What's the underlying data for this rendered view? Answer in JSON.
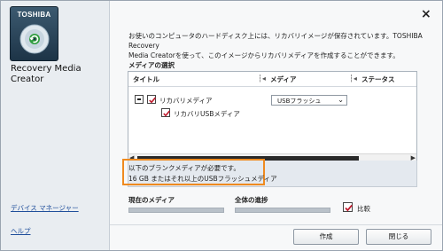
{
  "app": {
    "brand": "TOSHIBA",
    "title_line1": "Recovery Media",
    "title_line2": "Creator"
  },
  "sidebar": {
    "device_manager": "デバイス マネージャー",
    "help": "ヘルプ"
  },
  "close_glyph": "×",
  "message": {
    "line1": "お使いのコンピュータのハードディスク上には、リカバリイメージが保存されています。TOSHIBA Recovery",
    "line2": "Media Creatorを使って、このイメージからリカバリメディアを作成することができます。"
  },
  "media_selection": {
    "label": "メディアの選択",
    "columns": [
      "タイトル",
      "メディア",
      "ステータス"
    ],
    "items": [
      {
        "label": "リカバリメディア",
        "checked": true,
        "media": "USBフラッシュ"
      },
      {
        "label": "リカバリUSBメディア",
        "checked": true
      }
    ]
  },
  "info": {
    "line1": "以下のブランクメディアが必要です。",
    "count": "16",
    "line2_rest": " GB またはそれ以上のUSBフラッシュメディア"
  },
  "progress": {
    "current_label": "現在のメディア",
    "overall_label": "全体の進捗",
    "current_value": 0,
    "overall_value": 0
  },
  "compare": {
    "label": "比較",
    "checked": true
  },
  "buttons": {
    "create": "作成",
    "close": "閉じる"
  },
  "colors": {
    "highlight": "#ef8a1f",
    "link": "#1f4e9b"
  }
}
